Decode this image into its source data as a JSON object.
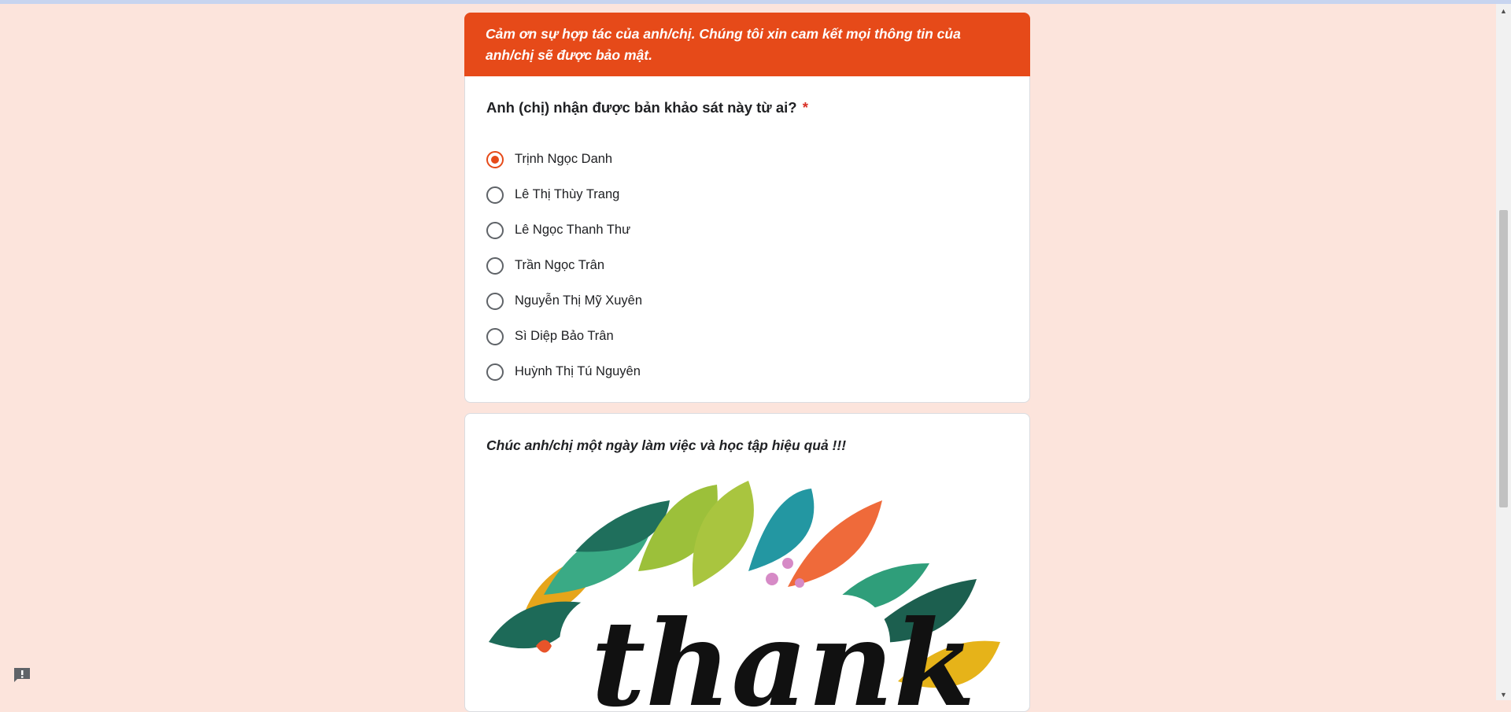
{
  "form": {
    "banner_text": "Cảm ơn sự hợp tác của anh/chị. Chúng tôi xin cam kết mọi thông tin của anh/chị sẽ được bảo mật.",
    "question": "Anh (chị) nhận được bản khảo sát này từ ai?",
    "required_marker": "*",
    "options": [
      {
        "label": "Trịnh Ngọc Danh",
        "selected": true
      },
      {
        "label": "Lê Thị Thùy Trang",
        "selected": false
      },
      {
        "label": "Lê Ngọc Thanh Thư",
        "selected": false
      },
      {
        "label": "Trần Ngọc Trân",
        "selected": false
      },
      {
        "label": "Nguyễn Thị Mỹ Xuyên",
        "selected": false
      },
      {
        "label": "Sì Diệp Bảo Trân",
        "selected": false
      },
      {
        "label": "Huỳnh Thị Tú Nguyên",
        "selected": false
      }
    ],
    "closing_text": "Chúc anh/chị một ngày làm việc và học tập hiệu quả !!!",
    "image_word": "thank"
  },
  "theme": {
    "accent": "#e64a19",
    "background": "#fce4dc"
  },
  "icons": {
    "feedback": "report-feedback-icon",
    "scroll_up": "triangle-up-icon",
    "scroll_down": "triangle-down-icon"
  }
}
